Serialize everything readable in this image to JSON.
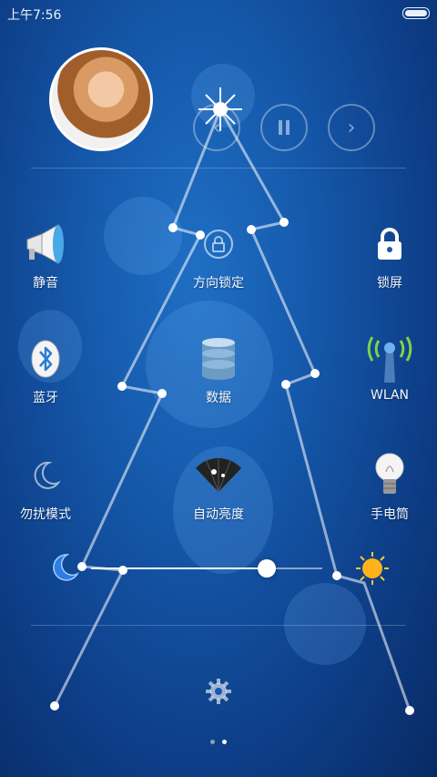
{
  "status_bar": {
    "time": "上午7:56"
  },
  "media": {
    "prev_icon": "chevron-left-icon",
    "pause_icon": "pause-icon",
    "next_icon": "chevron-right-icon"
  },
  "toggles": [
    {
      "label": "静音",
      "icon": "megaphone-icon"
    },
    {
      "label": "方向锁定",
      "icon": "rotation-lock-icon"
    },
    {
      "label": "锁屏",
      "icon": "lock-icon"
    },
    {
      "label": "蓝牙",
      "icon": "bluetooth-icon"
    },
    {
      "label": "数据",
      "icon": "database-icon"
    },
    {
      "label": "WLAN",
      "icon": "wifi-tower-icon"
    },
    {
      "label": "勿扰模式",
      "icon": "crescent-moon-icon"
    },
    {
      "label": "自动亮度",
      "icon": "fan-icon"
    },
    {
      "label": "手电筒",
      "icon": "lightbulb-icon"
    }
  ],
  "brightness": {
    "level": 0.76,
    "low_icon": "moon-icon",
    "high_icon": "sun-icon"
  },
  "pager": {
    "pages": 2,
    "current": 2
  },
  "colors": {
    "background": "#1558aa",
    "accent": "#ffffff"
  }
}
